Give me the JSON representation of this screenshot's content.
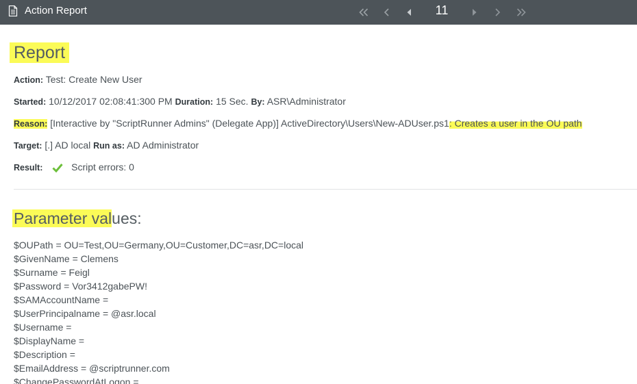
{
  "window": {
    "title": "Action Report",
    "icon": "document-icon"
  },
  "pager": {
    "current_page": "11",
    "controls": [
      "first-page-icon",
      "previous-page-icon",
      "step-back-icon",
      "step-forward-icon",
      "next-page-icon",
      "last-page-icon"
    ]
  },
  "report": {
    "heading": "Report",
    "action_label": "Action:",
    "action_value": "Test: Create New User",
    "started_label": "Started:",
    "started_value": "10/12/2017 02:08:41:300 PM",
    "duration_label": "Duration:",
    "duration_value": "15 Sec.",
    "by_label": "By:",
    "by_value": "ASR\\Administrator",
    "reason_label": "Reason:",
    "reason_value": "[Interactive by \"ScriptRunner Admins\" (Delegate App)] ActiveDirectory\\Users\\New-ADUser.ps1",
    "reason_tail": ": Creates a user in the OU path",
    "target_label": "Target:",
    "target_value": "[.] AD local",
    "runas_label": "Run as:",
    "runas_value": "AD Administrator",
    "result_label": "Result:",
    "result_icon": "checkmark-icon",
    "result_value": "Script errors:  0"
  },
  "parameters": {
    "heading_highlighted": "Parameter val",
    "heading_rest": "ues:",
    "lines": [
      "$OUPath = OU=Test,OU=Germany,OU=Customer,DC=asr,DC=local",
      "$GivenName = Clemens",
      "$Surname = Feigl",
      "$Password = Vor3412gabePW!",
      "$SAMAccountName =",
      "$UserPrincipalname = @asr.local",
      "$Username =",
      "$DisplayName =",
      "$Description =",
      "$EmailAddress = @scriptrunner.com",
      "$ChangePasswordAtLogon ="
    ]
  },
  "colors": {
    "titlebar": "#4d5459",
    "highlight": "#fbfb57",
    "check": "#6cbf3a",
    "text": "#4b5257"
  }
}
